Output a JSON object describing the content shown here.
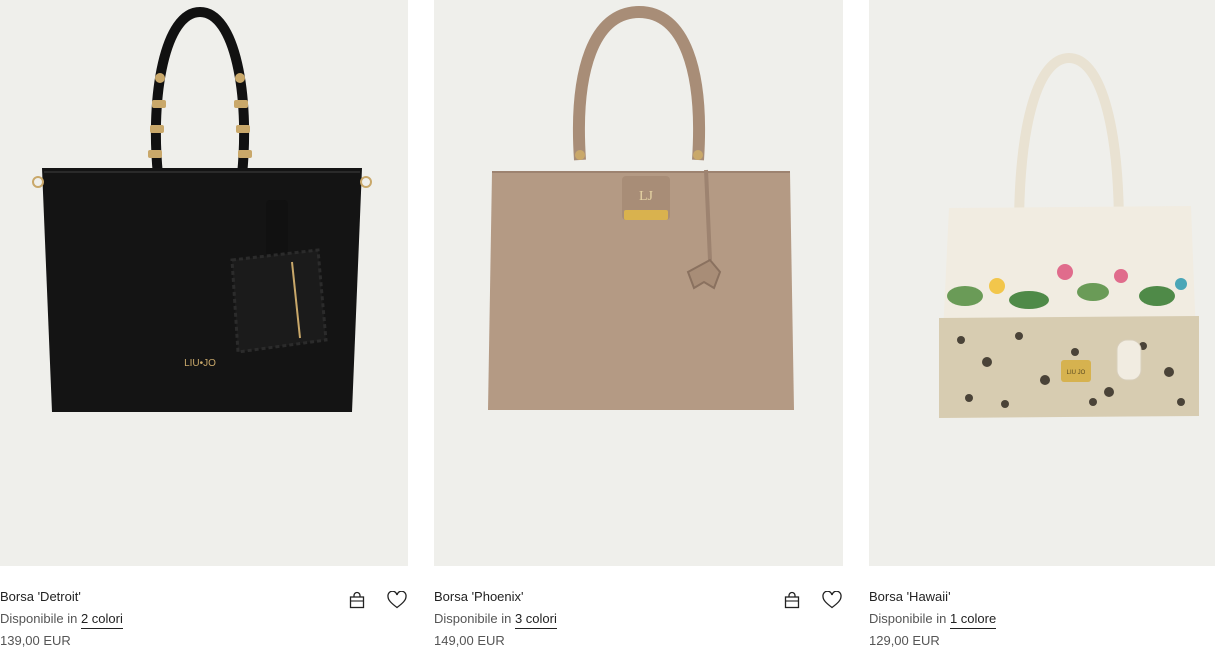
{
  "products": [
    {
      "name": "Borsa 'Detroit'",
      "available_prefix": "Disponibile in",
      "colors_link": "2 colori",
      "price": "139,00 EUR",
      "brand_mark": "LIU•JO"
    },
    {
      "name": "Borsa 'Phoenix'",
      "available_prefix": "Disponibile in",
      "colors_link": "3 colori",
      "price": "149,00 EUR",
      "brand_mark": "LJ"
    },
    {
      "name": "Borsa 'Hawaii'",
      "available_prefix": "Disponibile in",
      "colors_link": "1 colore",
      "price": "129,00 EUR",
      "brand_mark": "LIU JO"
    }
  ],
  "icons": {
    "bag": "shopping-bag-icon",
    "wishlist": "heart-icon"
  },
  "colors": {
    "image_background": "#efefeb",
    "bag_black": "#141414",
    "bag_taupe": "#b49a84",
    "bag_cream": "#f1ece1"
  }
}
